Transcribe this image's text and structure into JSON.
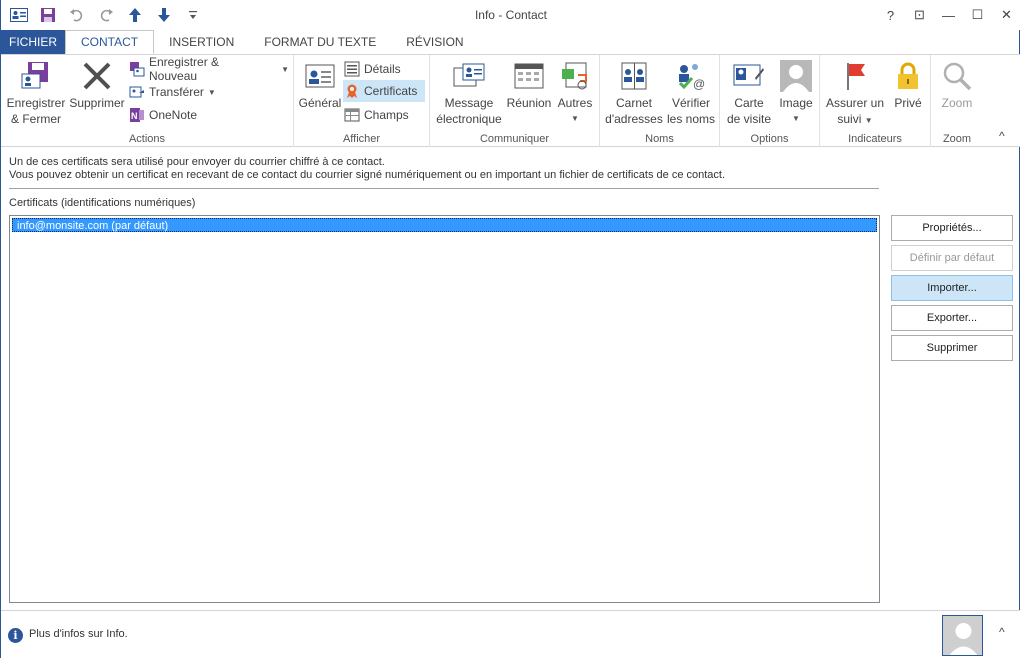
{
  "window": {
    "title": "Info - Contact"
  },
  "qat": [
    "contact-card-icon",
    "save-icon",
    "undo-icon",
    "redo-icon",
    "up-arrow-icon",
    "down-arrow-icon",
    "customize-icon"
  ],
  "controls": {
    "help": "?",
    "restore_ribbon": "⊡",
    "minimize": "—",
    "maximize": "☐",
    "close": "✕"
  },
  "tabs": [
    "FICHIER",
    "CONTACT",
    "INSERTION",
    "FORMAT DU TEXTE",
    "RÉVISION"
  ],
  "ribbon": {
    "actions": {
      "label": "Actions",
      "save_close_1": "Enregistrer",
      "save_close_2": "& Fermer",
      "delete": "Supprimer",
      "save_new": "Enregistrer & Nouveau",
      "forward": "Transférer",
      "onenote": "OneNote"
    },
    "show": {
      "label": "Afficher",
      "general": "Général",
      "details": "Détails",
      "certificates": "Certificats",
      "fields": "Champs"
    },
    "communicate": {
      "label": "Communiquer",
      "email_1": "Message",
      "email_2": "électronique",
      "meeting": "Réunion",
      "more": "Autres"
    },
    "names": {
      "label": "Noms",
      "address_book_1": "Carnet",
      "address_book_2": "d'adresses",
      "check_names_1": "Vérifier",
      "check_names_2": "les noms"
    },
    "options": {
      "label": "Options",
      "business_card_1": "Carte",
      "business_card_2": "de visite",
      "picture": "Image"
    },
    "tags": {
      "label": "Indicateurs",
      "followup_1": "Assurer un",
      "followup_2": "suivi",
      "private": "Privé"
    },
    "zoom": {
      "label": "Zoom",
      "zoom": "Zoom"
    }
  },
  "body": {
    "info_line1": "Un de ces certificats sera utilisé pour envoyer du courrier chiffré à ce contact.",
    "info_line2": "Vous pouvez obtenir un certificat en recevant de ce contact du courrier signé numériquement ou en important un fichier de certificats de ce contact.",
    "certs_label": "Certificats (identifications numériques)",
    "certs": [
      "info@monsite.com (par défaut)"
    ]
  },
  "buttons": {
    "properties": "Propriétés...",
    "set_default": "Définir par défaut",
    "import": "Importer...",
    "export": "Exporter...",
    "remove": "Supprimer"
  },
  "status": {
    "text": "Plus d'infos sur Info."
  }
}
